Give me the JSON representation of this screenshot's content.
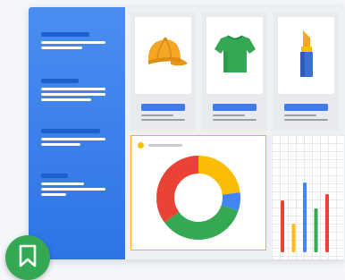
{
  "sidebar": {
    "items": [
      {
        "name": "nav-item-1"
      },
      {
        "name": "nav-item-2"
      },
      {
        "name": "nav-item-3"
      },
      {
        "name": "nav-item-4"
      }
    ]
  },
  "products": [
    {
      "icon": "cap-icon",
      "color": "#f5a623"
    },
    {
      "icon": "tshirt-icon",
      "color": "#34a853"
    },
    {
      "icon": "lipstick-icon",
      "color": "#3b6fd4"
    }
  ],
  "chart_data": [
    {
      "type": "pie",
      "style": "donut",
      "slices": [
        {
          "color": "#fbbc04",
          "value": 23
        },
        {
          "color": "#4285f4",
          "value": 7
        },
        {
          "color": "#34a853",
          "value": 35
        },
        {
          "color": "#ea4335",
          "value": 35
        }
      ],
      "legend": "top-left",
      "grid": false
    },
    {
      "type": "bar",
      "values": [
        58,
        32,
        78,
        49,
        65
      ],
      "colors": [
        "#ea4335",
        "#fbbc04",
        "#4285f4",
        "#34a853",
        "#ea4335"
      ],
      "ylim": [
        0,
        100
      ],
      "grid": true
    }
  ],
  "colors": {
    "sidebar": "#2e74e6",
    "accent": "#3e7be6",
    "bookmark": "#34a853",
    "panel_border": "#f4b400"
  },
  "fab": {
    "icon": "bookmark-icon"
  }
}
